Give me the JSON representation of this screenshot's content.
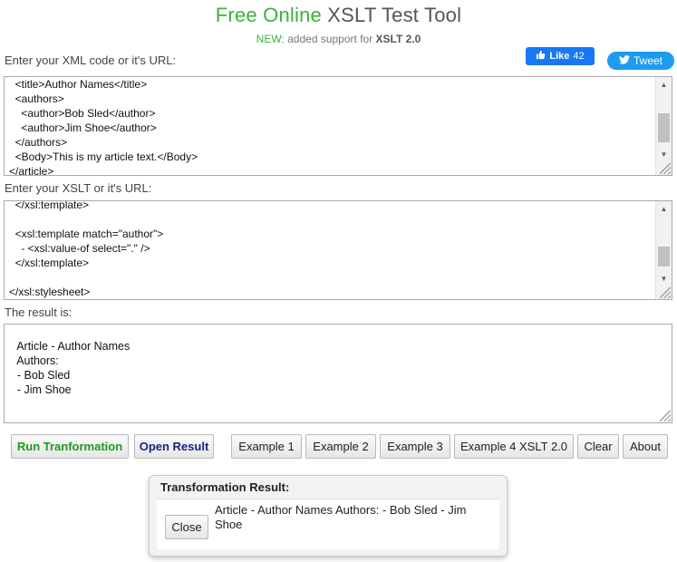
{
  "header": {
    "title_green": "Free Online",
    "title_rest": "XSLT Test Tool",
    "new_label": "NEW:",
    "new_text": "added support for",
    "new_bold": "XSLT 2.0"
  },
  "social": {
    "like_label": "Like",
    "like_count": "42",
    "tweet_label": "Tweet"
  },
  "xml": {
    "label": "Enter your XML code or it's URL:",
    "code": "  <title>Author Names</title>\n  <authors>\n    <author>Bob Sled</author>\n    <author>Jim Shoe</author>\n  </authors>\n  <Body>This is my article text.</Body>\n</article>"
  },
  "xslt": {
    "label": "Enter your XSLT or it's URL:",
    "code": "  </xsl:template>\n\n  <xsl:template match=\"author\">\n    - <xsl:value-of select=\".\" />\n  </xsl:template>\n\n</xsl:stylesheet>"
  },
  "result": {
    "label": "The result is:",
    "code": "\n    Article - Author Names\n    Authors:\n    - Bob Sled\n    - Jim Shoe"
  },
  "buttons": {
    "run": "Run Tranformation",
    "open": "Open Result",
    "ex1": "Example 1",
    "ex2": "Example 2",
    "ex3": "Example 3",
    "ex4": "Example 4 XSLT 2.0",
    "clear": "Clear",
    "about": "About"
  },
  "popup": {
    "title": "Transformation Result:",
    "close": "Close",
    "text": "Article - Author Names Authors: - Bob Sled - Jim Shoe"
  }
}
